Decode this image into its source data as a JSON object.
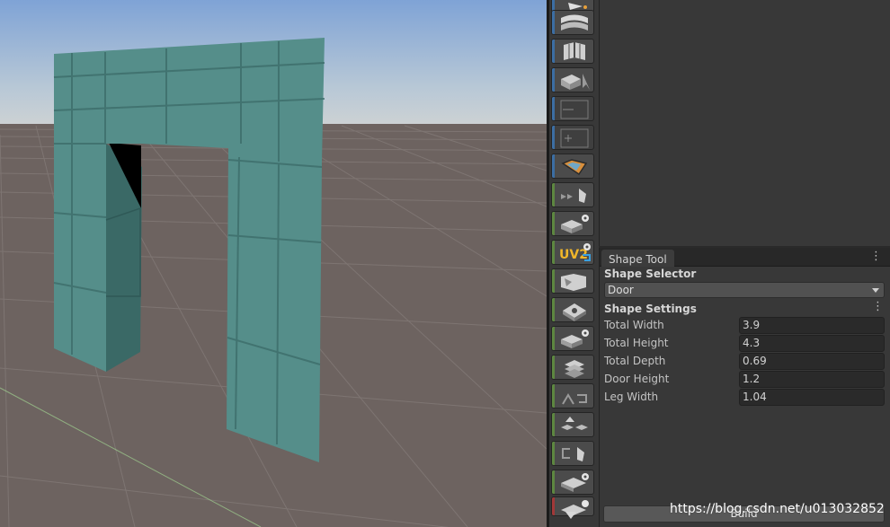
{
  "scene": {
    "sky_top": "#8fb0d8",
    "sky_horizon": "#c6d0d6",
    "ground_color": "#6f6560",
    "grid_color": "#7f7672",
    "door_face": "#568f8b",
    "door_side": "#3a6966",
    "door_shadow": "#000000"
  },
  "toolbar": {
    "icons": [
      "new-shape-icon",
      "poly-shape-icon",
      "material-editor-icon",
      "select-face-icon",
      "smoothing-groups-icon",
      "vertex-colors-icon",
      "uv-editor-icon",
      "merge-faces-icon",
      "extrude-settings-icon",
      "uv2-settings-icon",
      "flip-normals-icon",
      "center-pivot-icon",
      "conform-normals-icon",
      "export-icon",
      "connect-edges-icon",
      "detach-faces-icon",
      "bridge-edges-icon",
      "subdivide-settings-icon",
      "more-tools-icon"
    ],
    "uv2_text": "UV2",
    "strip_blue": "#3c6ea3",
    "strip_green": "#5d8740",
    "strip_red": "#a13838"
  },
  "shape_tool": {
    "tab_label": "Shape Tool",
    "selector_label": "Shape Selector",
    "selected_shape": "Door",
    "settings_label": "Shape Settings",
    "fields": [
      {
        "label": "Total Width",
        "value": "3.9"
      },
      {
        "label": "Total Height",
        "value": "4.3"
      },
      {
        "label": "Total Depth",
        "value": "0.69"
      },
      {
        "label": "Door Height",
        "value": "1.2"
      },
      {
        "label": "Leg Width",
        "value": "1.04"
      }
    ],
    "build_label": "Build"
  },
  "watermark": "https://blog.csdn.net/u013032852"
}
